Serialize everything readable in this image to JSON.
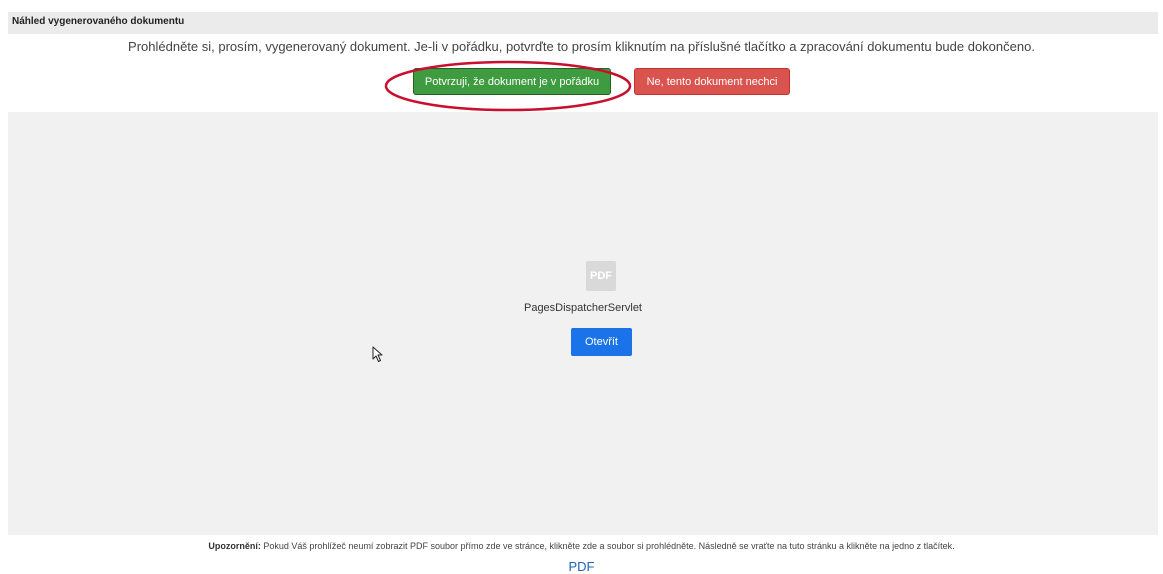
{
  "panel": {
    "title": "Náhled vygenerovaného dokumentu"
  },
  "instruction": "Prohlédněte si, prosím, vygenerovaný dokument. Je-li v pořádku, potvrďte to prosím kliknutím na příslušné tlačítko a zpracování dokumentu bude dokončeno.",
  "buttons": {
    "confirm_label": "Potvrzuji, že dokument je v pořádku",
    "reject_label": "Ne, tento dokument nechci"
  },
  "viewer": {
    "icon_text": "PDF",
    "file_name": "PagesDispatcherServlet",
    "open_label": "Otevřít"
  },
  "notice": {
    "label": "Upozornění:",
    "text": "Pokud Váš prohlížeč neumí zobrazit PDF soubor přímo zde ve stránce, klikněte zde a soubor si prohlédněte. Následně se vraťte na tuto stránku a klikněte na jedno z tlačítek."
  },
  "pdf_link": "PDF",
  "colors": {
    "confirm": "#3f9b3f",
    "reject": "#d9534f",
    "open": "#1a73e8",
    "highlight": "#c8102e"
  }
}
